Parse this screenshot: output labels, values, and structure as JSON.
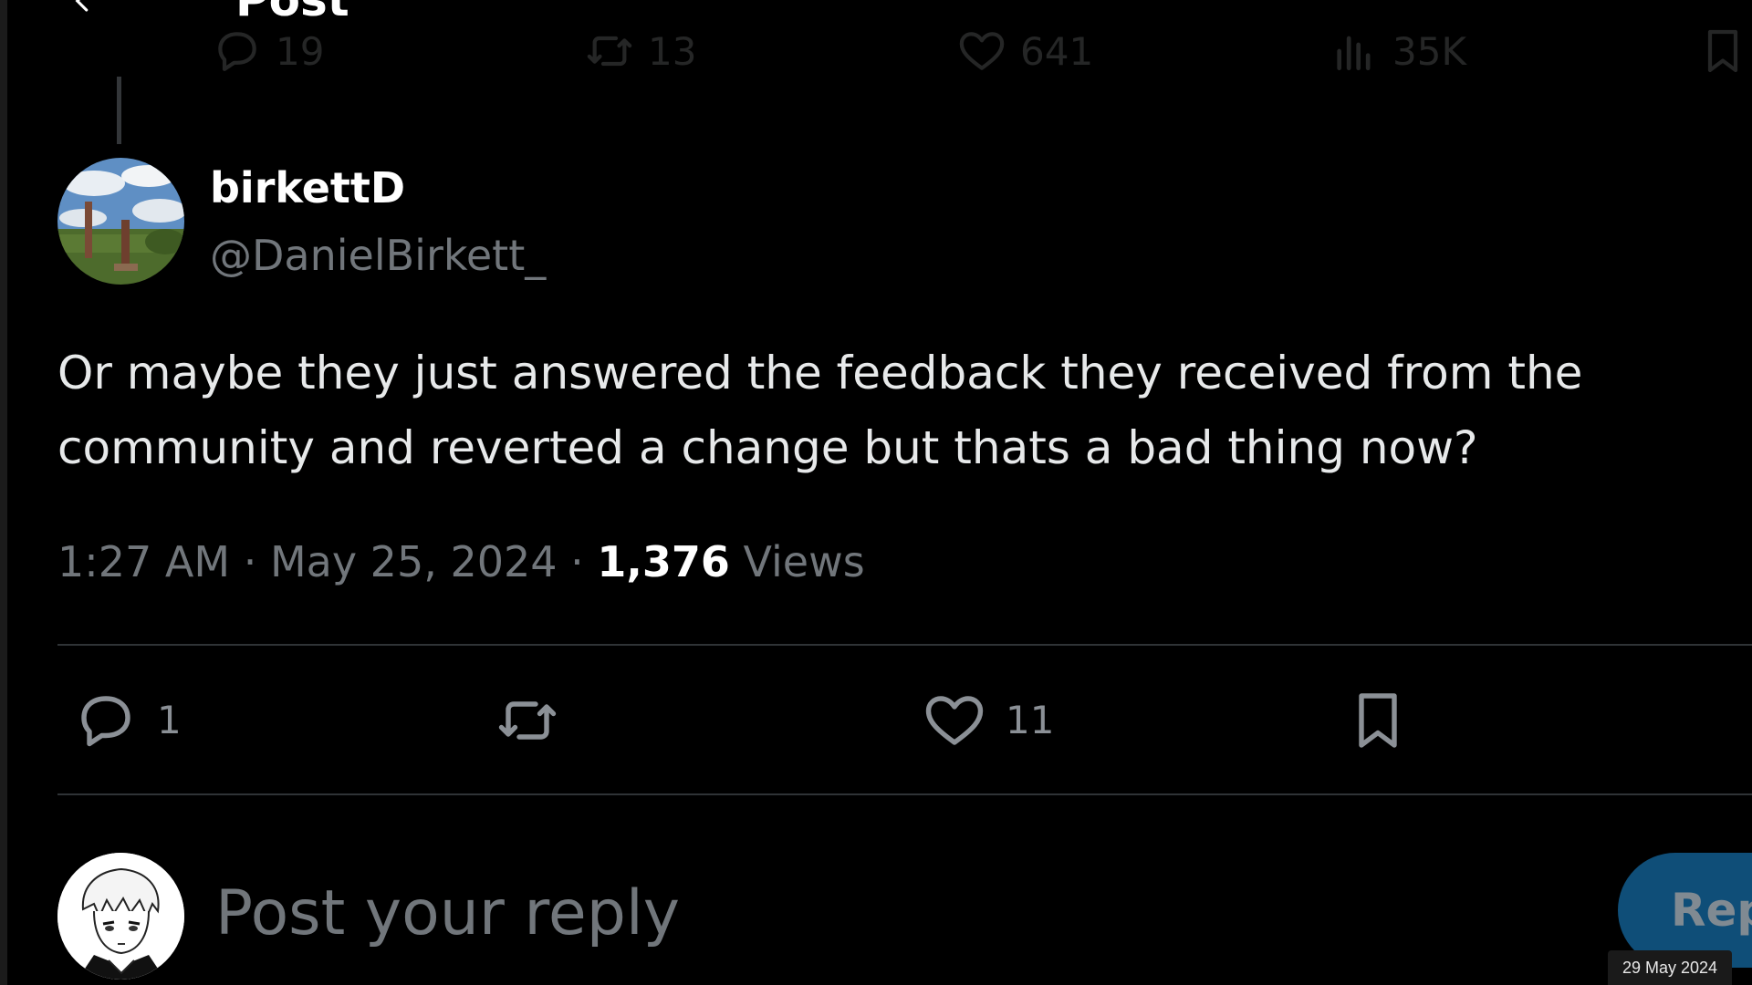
{
  "header": {
    "title": "Post"
  },
  "previous_post_actions": {
    "replies": "19",
    "reposts": "13",
    "likes": "641",
    "views": "35K"
  },
  "post": {
    "author_name": "birkettD",
    "author_handle": "@DanielBirkett_",
    "text": "Or maybe they just answered the feedback they received from the community and reverted a change but thats a bad thing now?",
    "time": "1:27 AM",
    "separator": "·",
    "date": "May 25, 2024",
    "views_count": "1,376",
    "views_label": "Views"
  },
  "actions": {
    "replies": "1",
    "likes": "11"
  },
  "composer": {
    "placeholder": "Post your reply",
    "reply_button": "Reply"
  },
  "overlay": {
    "date": "29 May 2024"
  },
  "icons": [
    "back-arrow-icon",
    "reply-icon",
    "repost-icon",
    "like-icon",
    "views-icon",
    "bookmark-icon"
  ],
  "colors": {
    "background": "#000000",
    "primary_text": "#e7e9ea",
    "secondary_text": "#71767b",
    "divider": "#2f3336",
    "reply_button": "#0f4e78"
  }
}
